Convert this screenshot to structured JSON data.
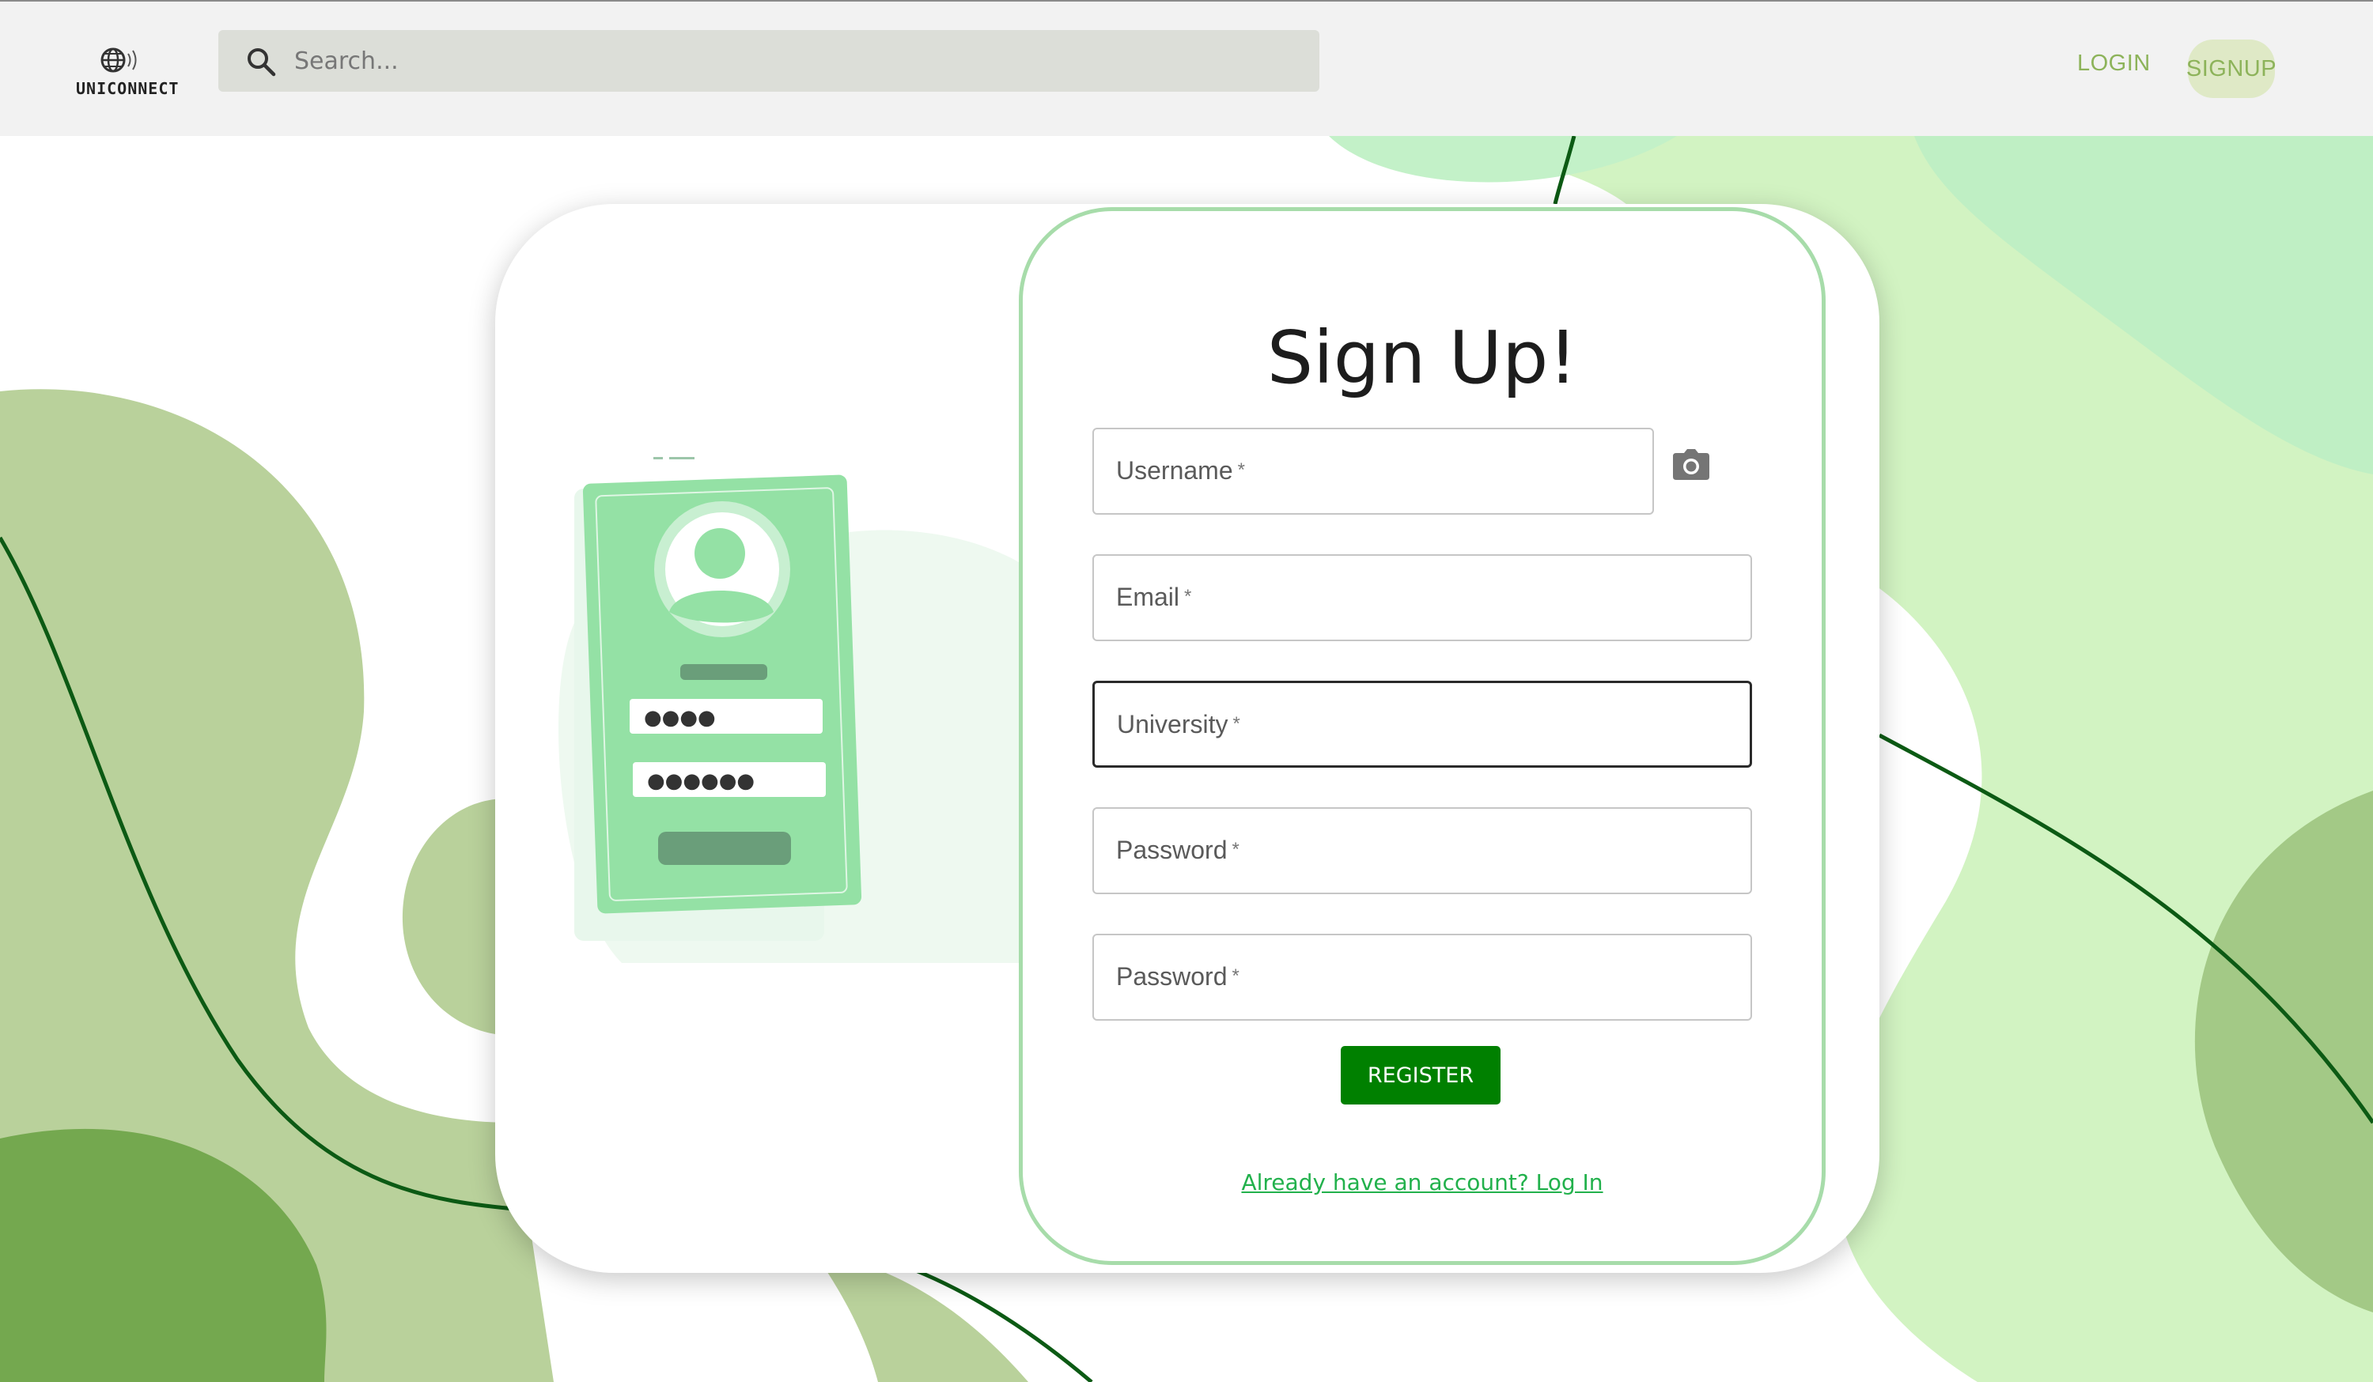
{
  "header": {
    "logo_text": "UNICONNECT",
    "search_placeholder": "Search...",
    "nav": {
      "login": "LOGIN",
      "signup": "SIGNUP"
    }
  },
  "form": {
    "title": "Sign Up!",
    "fields": [
      {
        "label": "Username",
        "required_mark": "*",
        "value": ""
      },
      {
        "label": "Email",
        "required_mark": "*",
        "value": ""
      },
      {
        "label": "University",
        "required_mark": "*",
        "value": ""
      },
      {
        "label": "Password",
        "required_mark": "*",
        "value": ""
      },
      {
        "label": "Password",
        "required_mark": "*",
        "value": ""
      }
    ],
    "register_label": "REGISTER",
    "login_link": "Already have an account? Log In"
  },
  "illustration": {
    "password_dots_1": "●●●●",
    "password_dots_2": "●●●●●●"
  },
  "icons": {
    "search": "search-icon",
    "camera": "camera-icon",
    "logo": "globe-icon"
  },
  "colors": {
    "brand_green": "#008000",
    "nav_accent": "#8db35a",
    "link_green": "#22b14c",
    "panel_border": "#a7dcaa"
  }
}
